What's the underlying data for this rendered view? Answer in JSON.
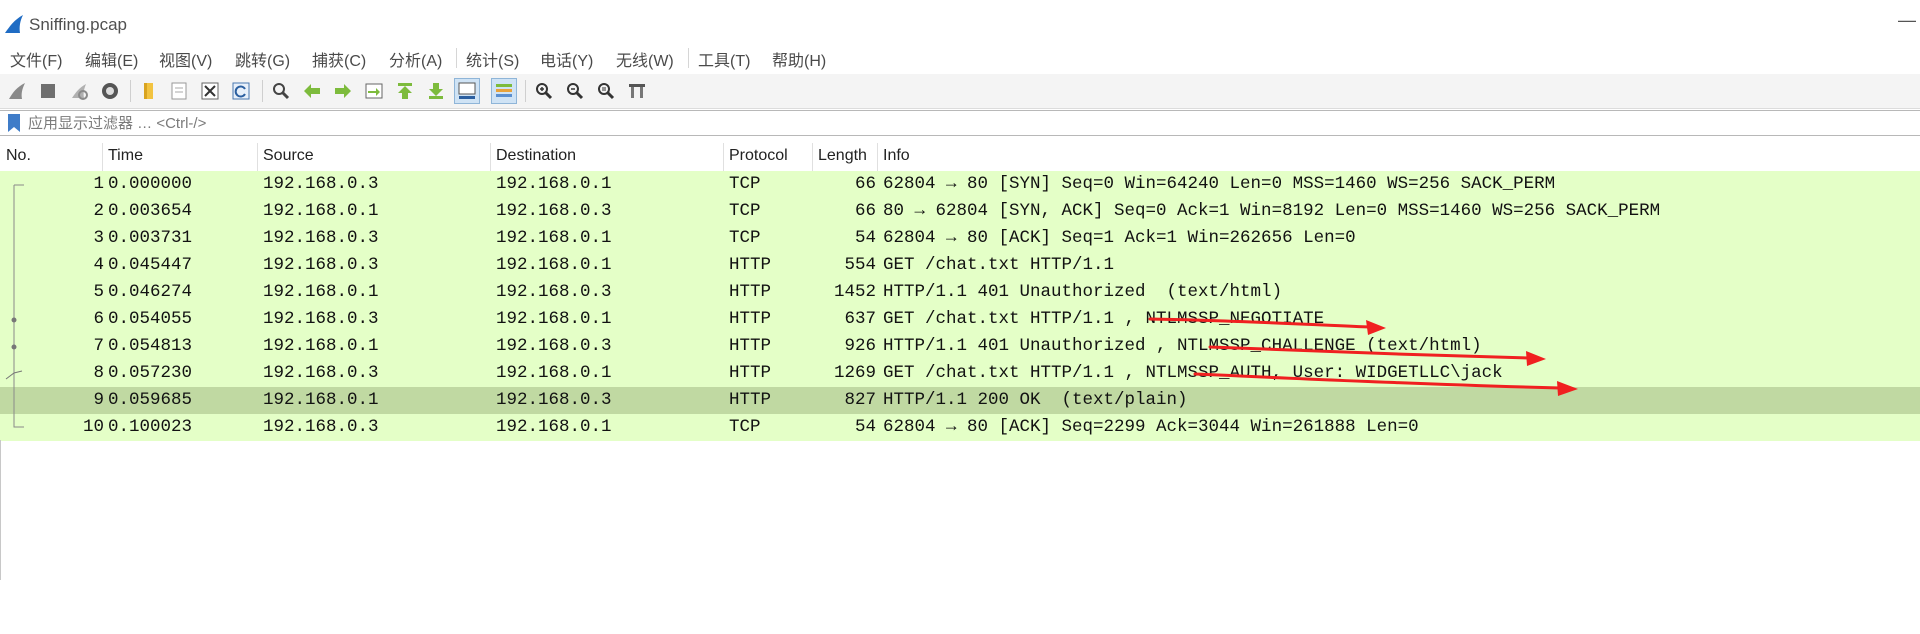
{
  "window": {
    "title": "Sniffing.pcap",
    "minimize_glyph": "—"
  },
  "menu": [
    "文件(F)",
    "编辑(E)",
    "视图(V)",
    "跳转(G)",
    "捕获(C)",
    "分析(A)",
    "统计(S)",
    "电话(Y)",
    "无线(W)",
    "工具(T)",
    "帮助(H)"
  ],
  "toolbar": {
    "icons": [
      "shark-fin-start-icon",
      "stop-icon",
      "restart-icon",
      "capture-options-icon",
      "open-file-icon",
      "save-file-icon",
      "close-file-icon",
      "reload-icon",
      "find-packet-icon",
      "go-back-icon",
      "go-forward-icon",
      "go-to-packet-icon",
      "go-first-icon",
      "go-last-icon",
      "auto-scroll-icon",
      "colorize-icon",
      "zoom-in-icon",
      "zoom-out-icon",
      "zoom-normal-icon",
      "resize-columns-icon"
    ]
  },
  "filter": {
    "placeholder": "应用显示过滤器 … <Ctrl-/>",
    "value": ""
  },
  "columns": {
    "no": "No.",
    "time": "Time",
    "source": "Source",
    "destination": "Destination",
    "protocol": "Protocol",
    "length": "Length",
    "info": "Info"
  },
  "packets": [
    {
      "no": "1",
      "time": "0.000000",
      "src": "192.168.0.3",
      "dst": "192.168.0.1",
      "proto": "TCP",
      "len": "66",
      "info": "62804 → 80 [SYN] Seq=0 Win=64240 Len=0 MSS=1460 WS=256 SACK_PERM"
    },
    {
      "no": "2",
      "time": "0.003654",
      "src": "192.168.0.1",
      "dst": "192.168.0.3",
      "proto": "TCP",
      "len": "66",
      "info": "80 → 62804 [SYN, ACK] Seq=0 Ack=1 Win=8192 Len=0 MSS=1460 WS=256 SACK_PERM"
    },
    {
      "no": "3",
      "time": "0.003731",
      "src": "192.168.0.3",
      "dst": "192.168.0.1",
      "proto": "TCP",
      "len": "54",
      "info": "62804 → 80 [ACK] Seq=1 Ack=1 Win=262656 Len=0"
    },
    {
      "no": "4",
      "time": "0.045447",
      "src": "192.168.0.3",
      "dst": "192.168.0.1",
      "proto": "HTTP",
      "len": "554",
      "info": "GET /chat.txt HTTP/1.1"
    },
    {
      "no": "5",
      "time": "0.046274",
      "src": "192.168.0.1",
      "dst": "192.168.0.3",
      "proto": "HTTP",
      "len": "1452",
      "info": "HTTP/1.1 401 Unauthorized  (text/html)"
    },
    {
      "no": "6",
      "time": "0.054055",
      "src": "192.168.0.3",
      "dst": "192.168.0.1",
      "proto": "HTTP",
      "len": "637",
      "info": "GET /chat.txt HTTP/1.1 , NTLMSSP_NEGOTIATE"
    },
    {
      "no": "7",
      "time": "0.054813",
      "src": "192.168.0.1",
      "dst": "192.168.0.3",
      "proto": "HTTP",
      "len": "926",
      "info": "HTTP/1.1 401 Unauthorized , NTLMSSP_CHALLENGE (text/html)"
    },
    {
      "no": "8",
      "time": "0.057230",
      "src": "192.168.0.3",
      "dst": "192.168.0.1",
      "proto": "HTTP",
      "len": "1269",
      "info": "GET /chat.txt HTTP/1.1 , NTLMSSP_AUTH, User: WIDGETLLC\\jack"
    },
    {
      "no": "9",
      "time": "0.059685",
      "src": "192.168.0.1",
      "dst": "192.168.0.3",
      "proto": "HTTP",
      "len": "827",
      "info": "HTTP/1.1 200 OK  (text/plain)",
      "selected": true
    },
    {
      "no": "10",
      "time": "0.100023",
      "src": "192.168.0.3",
      "dst": "192.168.0.1",
      "proto": "TCP",
      "len": "54",
      "info": "62804 → 80 [ACK] Seq=2299 Ack=3044 Win=261888 Len=0"
    }
  ],
  "colors": {
    "row_bg": "#e4ffc7",
    "row_selected_bg": "#c0d9a2",
    "annotation_arrow": "#f02020"
  }
}
